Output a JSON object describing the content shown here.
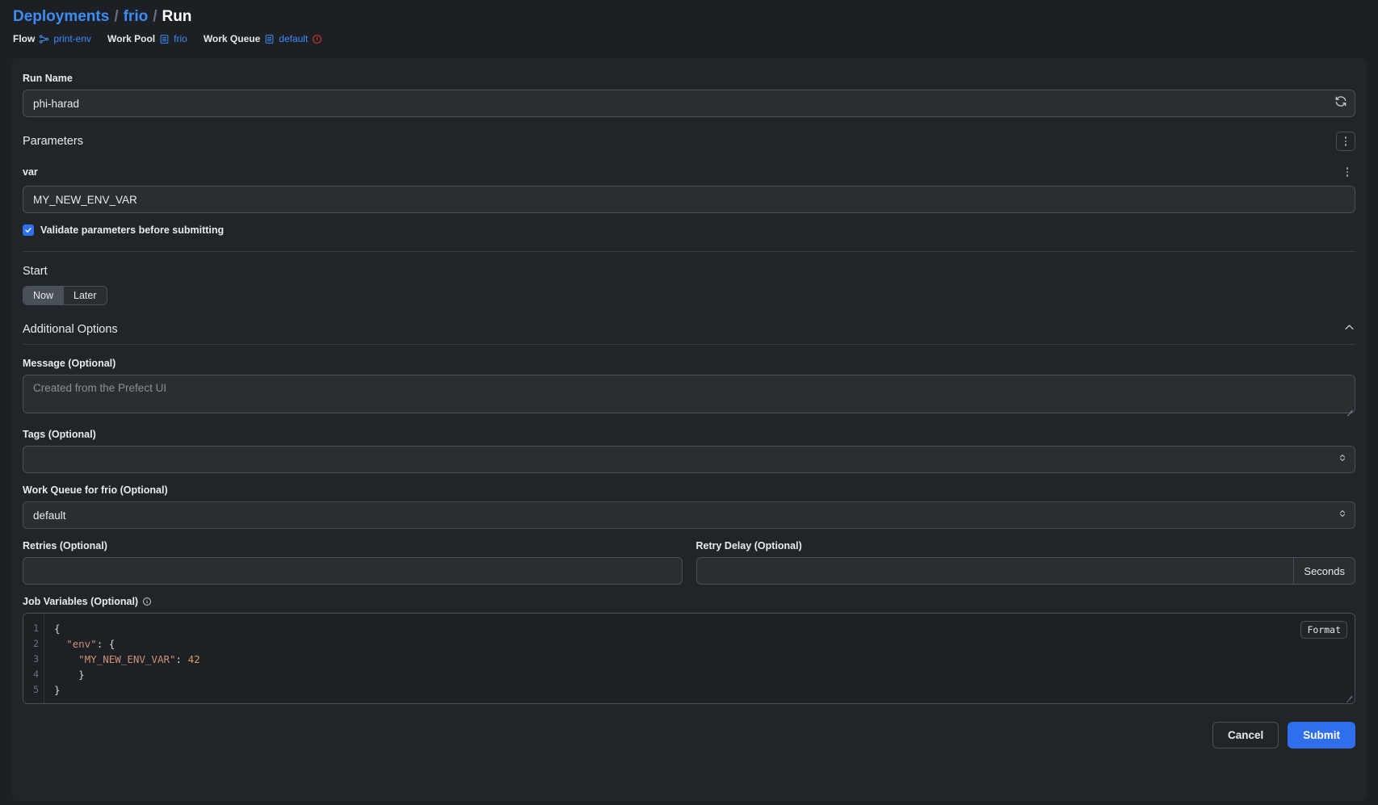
{
  "breadcrumb": {
    "root": "Deployments",
    "sep": "/",
    "deployment": "frio",
    "current": "Run"
  },
  "meta": {
    "flow_label": "Flow",
    "flow_value": "print-env",
    "work_pool_label": "Work Pool",
    "work_pool_value": "frio",
    "work_queue_label": "Work Queue",
    "work_queue_value": "default"
  },
  "run_name": {
    "label": "Run Name",
    "value": "phi-harad"
  },
  "parameters": {
    "title": "Parameters",
    "var_label": "var",
    "var_value": "MY_NEW_ENV_VAR",
    "validate_label": "Validate parameters before submitting",
    "validate_checked": true
  },
  "start": {
    "title": "Start",
    "options": [
      "Now",
      "Later"
    ],
    "selected": "Now"
  },
  "additional_options": {
    "title": "Additional Options",
    "expanded": true,
    "message_label": "Message (Optional)",
    "message_value": "",
    "message_placeholder": "Created from the Prefect UI",
    "tags_label": "Tags (Optional)",
    "tags_value": "",
    "work_queue_label": "Work Queue for frio (Optional)",
    "work_queue_value": "default",
    "retries_label": "Retries (Optional)",
    "retries_value": "",
    "retry_delay_label": "Retry Delay (Optional)",
    "retry_delay_value": "",
    "retry_delay_suffix": "Seconds",
    "job_variables_label": "Job Variables (Optional)",
    "format_button": "Format"
  },
  "editor": {
    "line_numbers": [
      "1",
      "2",
      "3",
      "4",
      "5"
    ],
    "lines": [
      {
        "indent": 0,
        "parts": [
          {
            "t": "{",
            "c": "pun"
          }
        ]
      },
      {
        "indent": 1,
        "parts": [
          {
            "t": "\"env\"",
            "c": "key"
          },
          {
            "t": ": {",
            "c": "pun"
          }
        ]
      },
      {
        "indent": 2,
        "parts": [
          {
            "t": "\"MY_NEW_ENV_VAR\"",
            "c": "key"
          },
          {
            "t": ": ",
            "c": "pun"
          },
          {
            "t": "42",
            "c": "num"
          }
        ]
      },
      {
        "indent": 2,
        "parts": [
          {
            "t": "}",
            "c": "pun"
          }
        ]
      },
      {
        "indent": 0,
        "parts": [
          {
            "t": "}",
            "c": "pun"
          }
        ]
      }
    ],
    "raw": "{\n  \"env\": {\n    \"MY_NEW_ENV_VAR\": 42\n  }\n}"
  },
  "footer": {
    "cancel": "Cancel",
    "submit": "Submit"
  },
  "colors": {
    "accent": "#2f6fed",
    "link": "#3d8df5",
    "page_bg": "#1c1f24",
    "card_bg": "#212529",
    "input_bg": "#2a2e33",
    "border": "#4b5058",
    "warning": "#d9322c",
    "json_key": "#ce9178",
    "json_num": "#d9a05b"
  }
}
